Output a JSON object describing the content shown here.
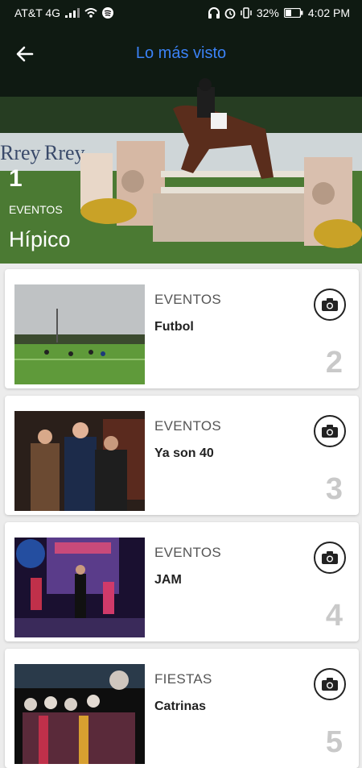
{
  "status_bar": {
    "carrier": "AT&T 4G",
    "battery": "32%",
    "time": "4:02 PM"
  },
  "app_bar": {
    "title": "Lo más visto",
    "back_icon": "arrow-left-icon"
  },
  "hero": {
    "rank": "1",
    "category": "EVENTOS",
    "title": "Hípico",
    "banner_text": "Rrey"
  },
  "items": [
    {
      "category": "EVENTOS",
      "title": "Futbol",
      "rank": "2"
    },
    {
      "category": "EVENTOS",
      "title": "Ya son 40",
      "rank": "3"
    },
    {
      "category": "EVENTOS",
      "title": "JAM",
      "rank": "4"
    },
    {
      "category": "FIESTAS",
      "title": "Catrinas",
      "rank": "5"
    }
  ],
  "colors": {
    "accent": "#3b82f6",
    "rank_gray": "#c9c9c9"
  }
}
